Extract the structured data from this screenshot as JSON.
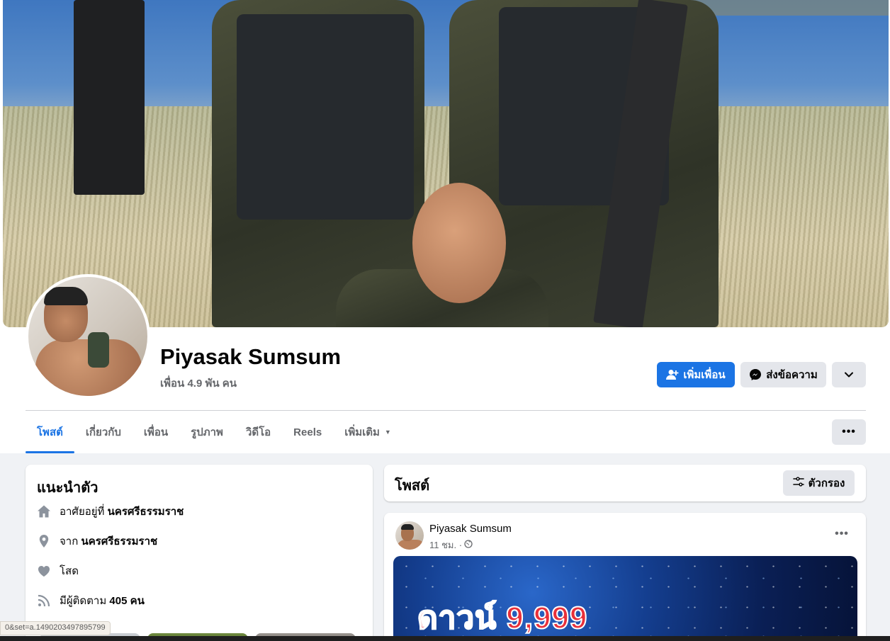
{
  "profile": {
    "name": "Piyasak Sumsum",
    "friends": "เพื่อน 4.9 พัน คน"
  },
  "actions": {
    "add_friend": "เพิ่มเพื่อน",
    "message": "ส่งข้อความ"
  },
  "tabs": [
    {
      "label": "โพสต์",
      "active": true
    },
    {
      "label": "เกี่ยวกับ"
    },
    {
      "label": "เพื่อน"
    },
    {
      "label": "รูปภาพ"
    },
    {
      "label": "วิดีโอ"
    },
    {
      "label": "Reels"
    },
    {
      "label": "เพิ่มเติม"
    }
  ],
  "intro": {
    "title": "แนะนำตัว",
    "lives_prefix": "อาศัยอยู่ที่",
    "lives_value": "นครศรีธรรมราช",
    "from_prefix": "จาก",
    "from_value": "นครศรีธรรมราช",
    "relationship": "โสด",
    "followers_prefix": "มีผู้ติดตาม",
    "followers_value": "405 คน"
  },
  "posts": {
    "title": "โพสต์",
    "filter_label": "ตัวกรอง"
  },
  "post": {
    "author": "Piyasak Sumsum",
    "time": "11 ชม. ·",
    "image_text": "ดาวน์ 9,999"
  },
  "status_url": "0&set=a.1490203497895799",
  "colors": {
    "accent": "#1b74e4",
    "secondary_button": "#e4e6eb",
    "page_background": "#f0f2f5"
  },
  "icons": [
    "add-friend-icon",
    "messenger-icon",
    "chevron-down-icon",
    "more-icon",
    "home-icon",
    "location-icon",
    "heart-icon",
    "rss-icon",
    "filter-icon",
    "globe-icon"
  ]
}
